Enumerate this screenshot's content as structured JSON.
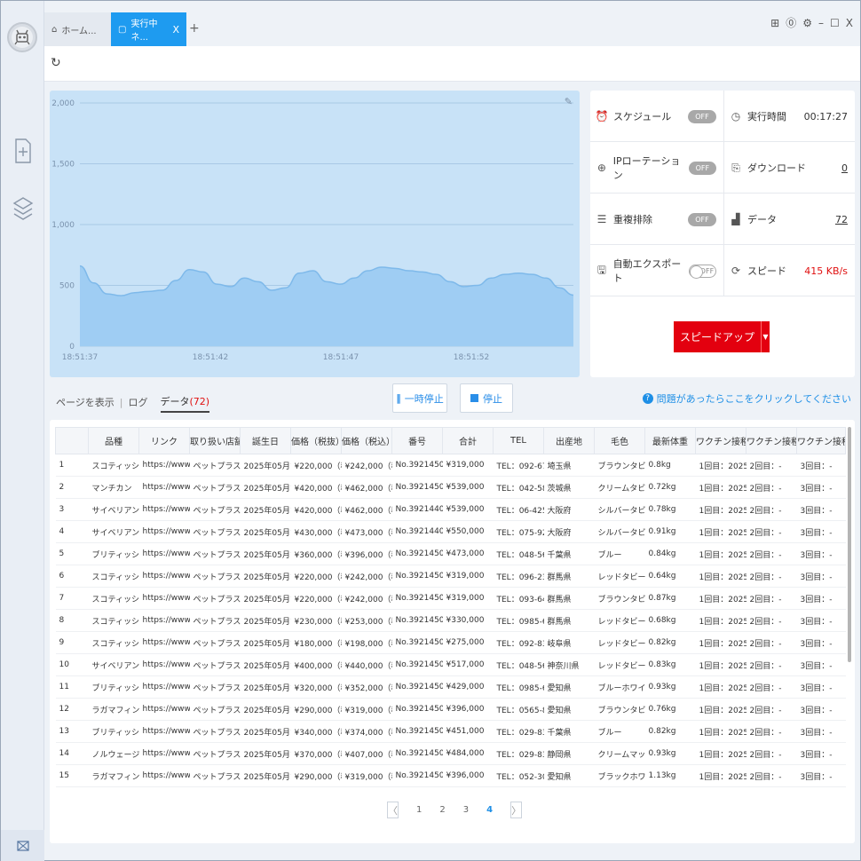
{
  "tabs": [
    {
      "label": "ホーム...",
      "icon": "home-icon"
    },
    {
      "label": "実行中ネ...",
      "icon": "page-icon",
      "close": "X"
    }
  ],
  "tab_add": "+",
  "window_controls": [
    "gift-icon",
    "help-icon",
    "settings-icon",
    "minimize-icon",
    "maximize-icon",
    "close-icon"
  ],
  "window_control_glyphs": {
    "minimize": "–",
    "maximize": "☐",
    "close": "X"
  },
  "chart_data": {
    "type": "area",
    "x": [
      "18:51:37",
      "18:51:42",
      "18:51:47",
      "18:51:52"
    ],
    "ylim": [
      0,
      2000
    ],
    "yticks": [
      "0",
      "500",
      "1,000",
      "1,500",
      "2,000"
    ],
    "y": [
      660,
      520,
      430,
      415,
      440,
      450,
      460,
      540,
      630,
      610,
      510,
      490,
      560,
      530,
      460,
      480,
      600,
      620,
      530,
      510,
      560,
      620,
      650,
      640,
      620,
      610,
      590,
      530,
      490,
      500,
      560,
      590,
      600,
      590,
      560,
      480,
      420
    ],
    "color": "#9fcdf3",
    "line_color": "#7eb9ea",
    "grid": true
  },
  "status": {
    "schedule": {
      "label": "スケジュール",
      "value": "OFF"
    },
    "run_time": {
      "label": "実行時間",
      "value": "00:17:27"
    },
    "ip_rotation": {
      "label": "IPローテーション",
      "value": "OFF"
    },
    "download": {
      "label": "ダウンロード",
      "value": "0"
    },
    "dedupe": {
      "label": "重複排除",
      "value": "OFF"
    },
    "data": {
      "label": "データ",
      "value": "72"
    },
    "auto_export": {
      "label": "自動エクスポート",
      "value": "OFF"
    },
    "speed": {
      "label": "スピード",
      "value": "415 KB/s"
    }
  },
  "speedup_label": "スピードアップ",
  "subtabs": {
    "page": "ページを表示",
    "log": "ログ",
    "data": "データ",
    "data_count_text": "(72)"
  },
  "buttons": {
    "pause": "一時停止",
    "stop": "停止"
  },
  "help_text": "問題があったらここをクリックしてください",
  "table": {
    "headers": [
      "",
      "品種",
      "リンク",
      "取り扱い店舗",
      "誕生日",
      "価格（税抜）",
      "価格（税込）",
      "番号",
      "合計",
      "TEL",
      "出産地",
      "毛色",
      "最新体重",
      "ワクチン接種1",
      "ワクチン接種2",
      "ワクチン接種3"
    ],
    "rows": [
      [
        "1",
        "スコティッシ...",
        "https://www.a...",
        "ペットプラス...",
        "2025年05月1...",
        "¥220,000（税...",
        "¥242,000（税...",
        "No.39214500...",
        "¥319,000",
        "TEL：092-67...",
        "埼玉県",
        "ブラウンタビ...",
        "0.8kg",
        "1回目：2025/...",
        "2回目：-",
        "3回目：-"
      ],
      [
        "2",
        "マンチカン",
        "https://www.a...",
        "ペットプラス...",
        "2025年05月1...",
        "¥420,000（税...",
        "¥462,000（税...",
        "No.39214500...",
        "¥539,000",
        "TEL：042-58...",
        "茨城県",
        "クリームタビ...",
        "0.72kg",
        "1回目：2025/...",
        "2回目：-",
        "3回目：-"
      ],
      [
        "3",
        "サイベリアン",
        "https://www.a...",
        "ペットプラス...",
        "2025年05月1...",
        "¥420,000（税...",
        "¥462,000（税...",
        "No.39214400...",
        "¥539,000",
        "TEL：06-425...",
        "大阪府",
        "シルバータビ...",
        "0.78kg",
        "1回目：2025/...",
        "2回目：-",
        "3回目：-"
      ],
      [
        "4",
        "サイベリアン",
        "https://www.a...",
        "ペットプラス...",
        "2025年05月1...",
        "¥430,000（税...",
        "¥473,000（税...",
        "No.39214400...",
        "¥550,000",
        "TEL：075-92...",
        "大阪府",
        "シルバータビ...",
        "0.91kg",
        "1回目：2025/...",
        "2回目：-",
        "3回目：-"
      ],
      [
        "5",
        "ブリティッシ...",
        "https://www.a...",
        "ペットプラス...",
        "2025年05月1...",
        "¥360,000（税...",
        "¥396,000（税...",
        "No.39214500...",
        "¥473,000",
        "TEL：048-56...",
        "千葉県",
        "ブルー",
        "0.84kg",
        "1回目：2025/...",
        "2回目：-",
        "3回目：-"
      ],
      [
        "6",
        "スコティッシ...",
        "https://www.a...",
        "ペットプラス...",
        "2025年05月1...",
        "¥220,000（税...",
        "¥242,000（税...",
        "No.39214500...",
        "¥319,000",
        "TEL：096-23...",
        "群馬県",
        "レッドタビー...",
        "0.64kg",
        "1回目：2025/...",
        "2回目：-",
        "3回目：-"
      ],
      [
        "7",
        "スコティッシ...",
        "https://www.a...",
        "ペットプラス...",
        "2025年05月1...",
        "¥220,000（税...",
        "¥242,000（税...",
        "No.39214500...",
        "¥319,000",
        "TEL：093-64...",
        "群馬県",
        "ブラウンタビー",
        "0.87kg",
        "1回目：2025/...",
        "2回目：-",
        "3回目：-"
      ],
      [
        "8",
        "スコティッシ...",
        "https://www.a...",
        "ペットプラス...",
        "2025年05月1...",
        "¥230,000（税...",
        "¥253,000（税...",
        "No.39214500...",
        "¥330,000",
        "TEL：0985-6...",
        "群馬県",
        "レッドタビー",
        "0.68kg",
        "1回目：2025/...",
        "2回目：-",
        "3回目：-"
      ],
      [
        "9",
        "スコティッシ...",
        "https://www.a...",
        "ペットプラス...",
        "2025年05月1...",
        "¥180,000（税...",
        "¥198,000（税...",
        "No.39214500...",
        "¥275,000",
        "TEL：092-83...",
        "岐阜県",
        "レッドタビー...",
        "0.82kg",
        "1回目：2025/...",
        "2回目：-",
        "3回目：-"
      ],
      [
        "10",
        "サイベリアン",
        "https://www.a...",
        "ペットプラス...",
        "2025年05月1...",
        "¥400,000（税...",
        "¥440,000（税...",
        "No.39214500...",
        "¥517,000",
        "TEL：048-56...",
        "神奈川県",
        "レッドタビー...",
        "0.83kg",
        "1回目：2025/...",
        "2回目：-",
        "3回目：-"
      ],
      [
        "11",
        "ブリティッシ...",
        "https://www.a...",
        "ペットプラス...",
        "2025年05月1...",
        "¥320,000（税...",
        "¥352,000（税...",
        "No.39214500...",
        "¥429,000",
        "TEL：0985-6...",
        "愛知県",
        "ブルーホワイト",
        "0.93kg",
        "1回目：2025/...",
        "2回目：-",
        "3回目：-"
      ],
      [
        "12",
        "ラガマフィン",
        "https://www.a...",
        "ペットプラス...",
        "2025年05月1...",
        "¥290,000（税...",
        "¥319,000（税...",
        "No.39214500...",
        "¥396,000",
        "TEL：0565-8...",
        "愛知県",
        "ブラウンタビ...",
        "0.76kg",
        "1回目：2025/...",
        "2回目：-",
        "3回目：-"
      ],
      [
        "13",
        "ブリティッシ...",
        "https://www.a...",
        "ペットプラス...",
        "2025年05月1...",
        "¥340,000（税...",
        "¥374,000（税...",
        "No.39214500...",
        "¥451,000",
        "TEL：029-83...",
        "千葉県",
        "ブルー",
        "0.82kg",
        "1回目：2025/...",
        "2回目：-",
        "3回目：-"
      ],
      [
        "14",
        "ノルウェージ...",
        "https://www.a...",
        "ペットプラス...",
        "2025年05月1...",
        "¥370,000（税...",
        "¥407,000（税...",
        "No.39214500...",
        "¥484,000",
        "TEL：029-83...",
        "静岡県",
        "クリームマッ...",
        "0.93kg",
        "1回目：2025/...",
        "2回目：-",
        "3回目：-"
      ],
      [
        "15",
        "ラガマフィン",
        "https://www.a...",
        "ペットプラス...",
        "2025年05月1...",
        "¥290,000（税...",
        "¥319,000（税...",
        "No.39214500...",
        "¥396,000",
        "TEL：052-30...",
        "愛知県",
        "ブラックホワ...",
        "1.13kg",
        "1回目：2025/...",
        "2回目：-",
        "3回目：-"
      ]
    ]
  },
  "pager": {
    "pages": [
      "1",
      "2",
      "3",
      "4"
    ],
    "current": "4",
    "prev": "〈",
    "next": "〉"
  }
}
